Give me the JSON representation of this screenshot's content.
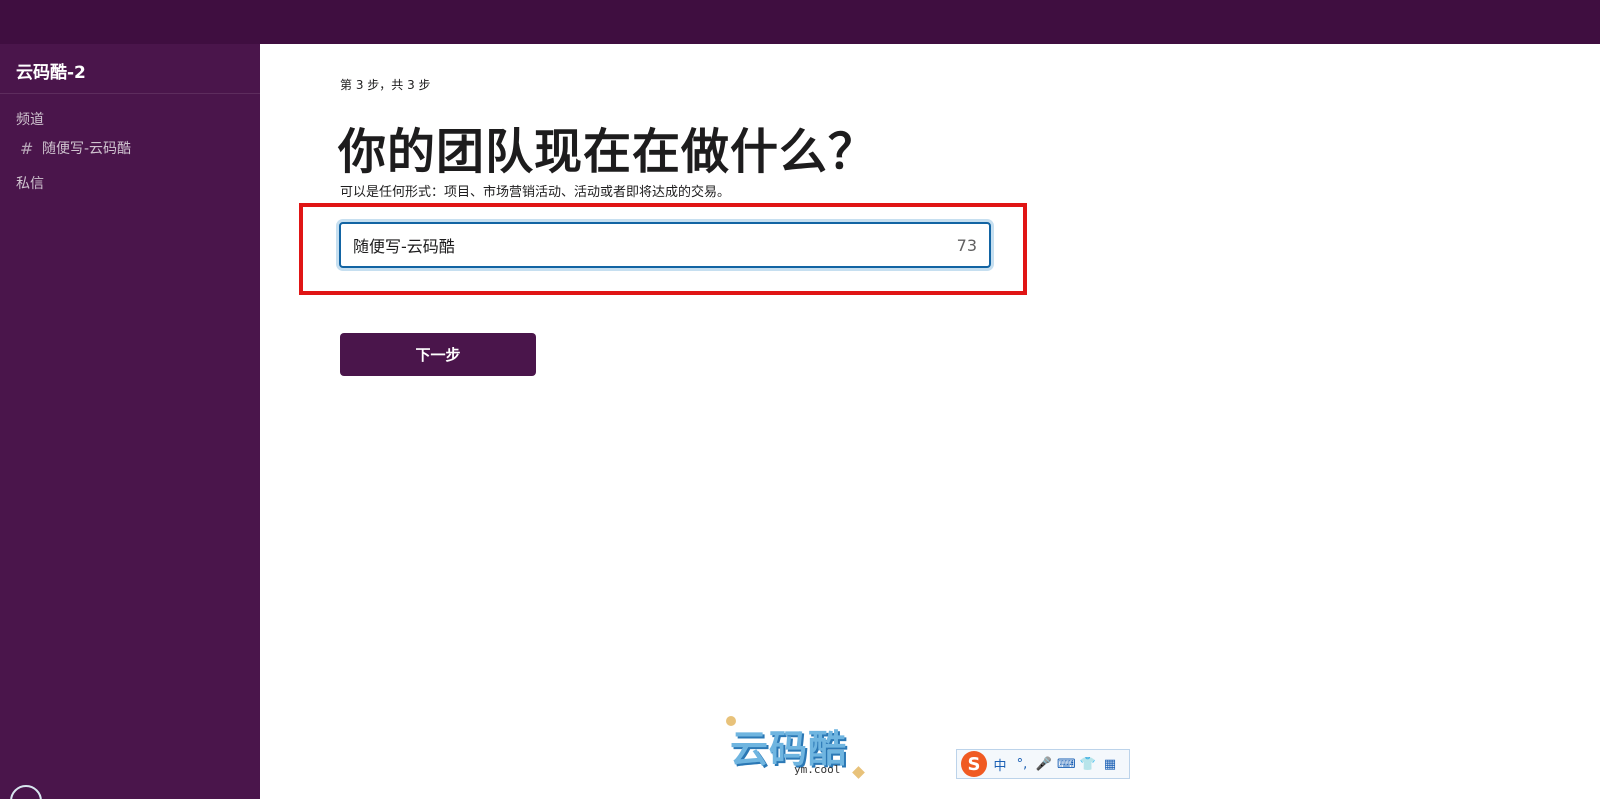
{
  "sidebar": {
    "workspace_name": "云码酷-2",
    "channels_label": "频道",
    "channels": [
      {
        "hash": "#",
        "name": "随便写-云码酷"
      }
    ],
    "dm_label": "私信"
  },
  "main": {
    "step_text": "第 3 步，共 3 步",
    "title": "你的团队现在在做什么？",
    "subtitle": "可以是任何形式：项目、市场营销活动、活动或者即将达成的交易。",
    "input_value": "随便写-云码酷",
    "char_counter": "73",
    "next_button_label": "下一步"
  },
  "watermark": {
    "main": "云码酷",
    "sub": "ym.cool"
  },
  "ime_toolbar": {
    "logo": "S",
    "items": [
      "中",
      "°,",
      "🎤",
      "⌨",
      "👕",
      "▦"
    ]
  },
  "colors": {
    "sidebar_bg": "#4a154b",
    "topbar_bg": "#3f0e40",
    "button_bg": "#4a154b",
    "highlight_border": "#e01515",
    "input_focus": "#1264a3"
  }
}
